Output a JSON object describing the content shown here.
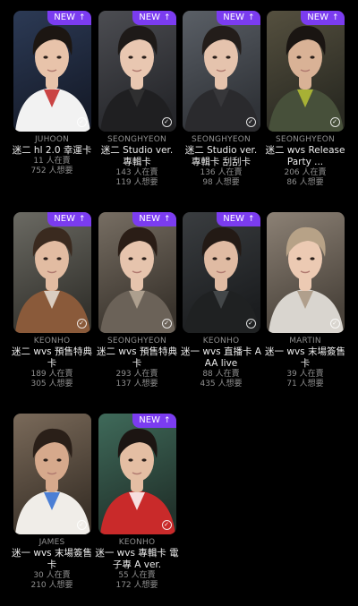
{
  "colors": {
    "background": "#000000",
    "badge": "#7b3cf0",
    "artist_text": "#8f8f8f",
    "title_text": "#ececec"
  },
  "icons": {
    "new_badge_arrow": "arrow-up-icon",
    "card_check": "check-circle-icon"
  },
  "badge_label": "NEW",
  "cards": [
    {
      "artist": "JUHOON",
      "title": "迷二 hl 2.0 幸運卡",
      "sell": "11 人在賣",
      "want": "752 人想要",
      "new": true
    },
    {
      "artist": "SEONGHYEON",
      "title": "迷二 Studio ver. 專輯卡",
      "sell": "143 人在賣",
      "want": "119 人想要",
      "new": true
    },
    {
      "artist": "SEONGHYEON",
      "title": "迷二 Studio ver. 專輯卡 刮刮卡",
      "sell": "136 人在賣",
      "want": "98 人想要",
      "new": true
    },
    {
      "artist": "SEONGHYEON",
      "title": "迷二 wvs Release Party ...",
      "sell": "206 人在賣",
      "want": "86 人想要",
      "new": true
    },
    {
      "artist": "KEONHO",
      "title": "迷二 wvs 預售特典卡",
      "sell": "189 人在賣",
      "want": "305 人想要",
      "new": true
    },
    {
      "artist": "SEONGHYEON",
      "title": "迷二 wvs 預售特典卡",
      "sell": "293 人在賣",
      "want": "137 人想要",
      "new": true
    },
    {
      "artist": "KEONHO",
      "title": "迷一 wvs 直播卡 AAA live",
      "sell": "88 人在賣",
      "want": "435 人想要",
      "new": true
    },
    {
      "artist": "MARTIN",
      "title": "迷一 wvs 末場簽售卡",
      "sell": "39 人在賣",
      "want": "71 人想要",
      "new": false
    },
    {
      "artist": "JAMES",
      "title": "迷一 wvs 末場簽售卡",
      "sell": "30 人在賣",
      "want": "210 人想要",
      "new": false
    },
    {
      "artist": "KEONHO",
      "title": "迷一 wvs 專輯卡 電子專 A ver.",
      "sell": "55 人在賣",
      "want": "172 人想要",
      "new": true
    }
  ]
}
